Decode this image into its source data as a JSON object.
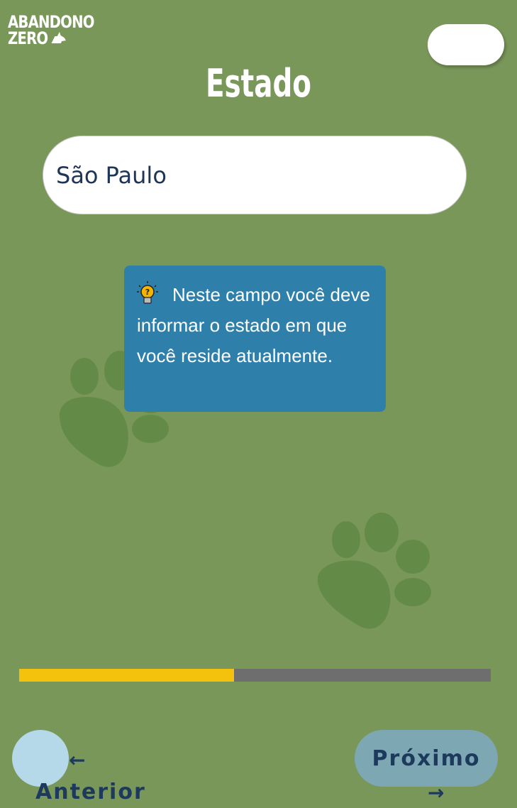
{
  "header": {
    "logo_line1": "ABANDONO",
    "logo_line2": "ZERO"
  },
  "page_title": "Estado",
  "state_field": {
    "value": "São Paulo"
  },
  "tip": {
    "icon": "lightbulb-icon",
    "text": "Neste campo você deve informar o estado em que você reside atualmente."
  },
  "progress": {
    "fraction": 0.455,
    "fill_color": "#f4c20d",
    "track_color": "#6e6e6e"
  },
  "nav": {
    "prev_arrow": "←",
    "prev_label": "Anterior",
    "next_label": "Próximo",
    "next_arrow": "→"
  },
  "colors": {
    "background": "#7a975a",
    "paw": "#648a48",
    "tip_background": "#2e80ab",
    "nav_text": "#1d3a5c"
  }
}
